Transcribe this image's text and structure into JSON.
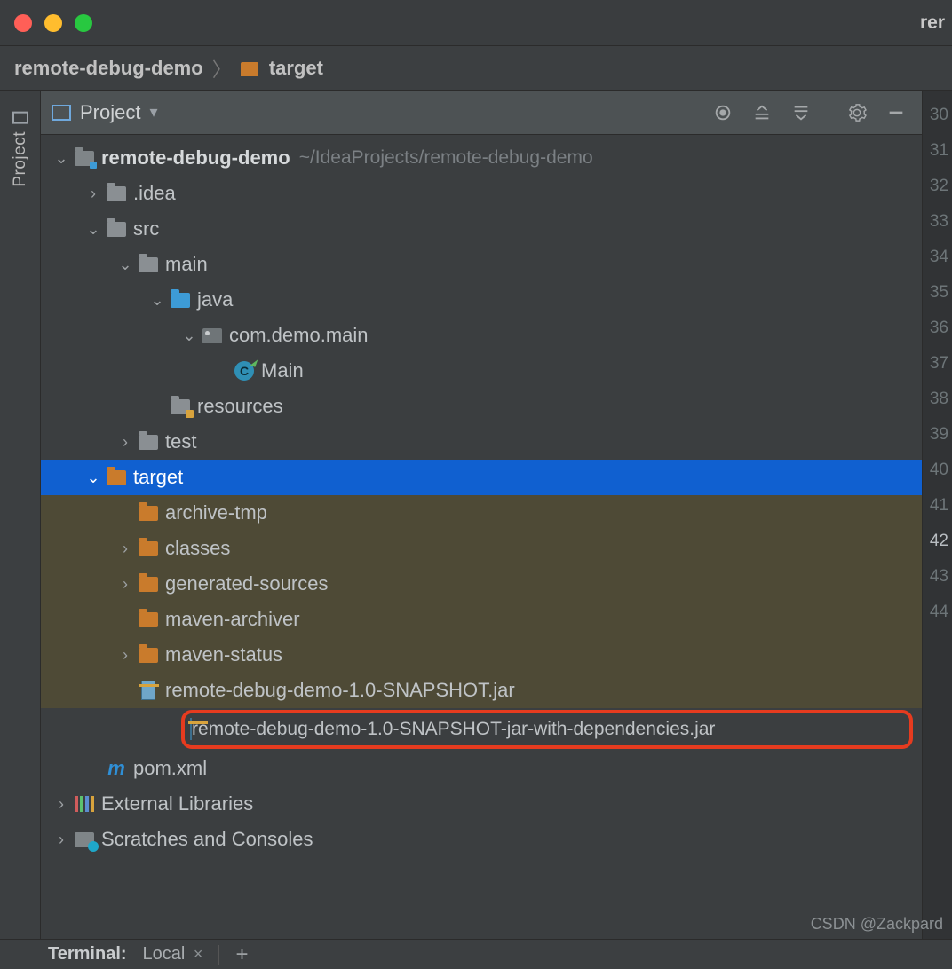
{
  "titlebar": {
    "title_fragment": "rer"
  },
  "breadcrumb": {
    "root": "remote-debug-demo",
    "target": "target"
  },
  "panel": {
    "title": "Project"
  },
  "gutter": {
    "label": "Project"
  },
  "tree": {
    "root": {
      "name": "remote-debug-demo",
      "path": "~/IdeaProjects/remote-debug-demo"
    },
    "idea": ".idea",
    "src": "src",
    "main": "main",
    "java": "java",
    "package": "com.demo.main",
    "main_class": "Main",
    "resources": "resources",
    "test": "test",
    "target": "target",
    "archive_tmp": "archive-tmp",
    "classes": "classes",
    "generated_sources": "generated-sources",
    "maven_archiver": "maven-archiver",
    "maven_status": "maven-status",
    "jar1": "remote-debug-demo-1.0-SNAPSHOT.jar",
    "jar2": "remote-debug-demo-1.0-SNAPSHOT-jar-with-dependencies.jar",
    "pom": "pom.xml",
    "ext_libs": "External Libraries",
    "scratches": "Scratches and Consoles"
  },
  "editor_lines": [
    "30",
    "31",
    "32",
    "33",
    "34",
    "35",
    "36",
    "37",
    "38",
    "39",
    "40",
    "41",
    "42",
    "43",
    "44"
  ],
  "editor_highlight_line": "42",
  "bottom": {
    "terminal_label": "Terminal:",
    "tab_label": "Local"
  },
  "watermark": "CSDN @Zackpard"
}
